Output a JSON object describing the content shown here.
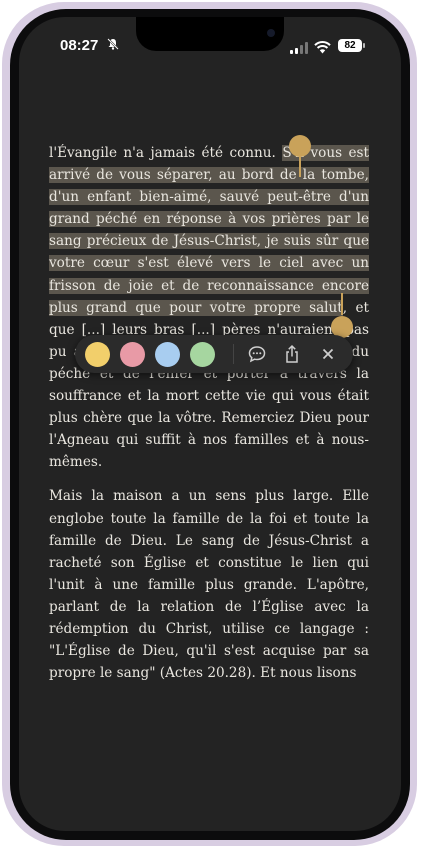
{
  "status": {
    "time": "08:27",
    "battery": "82"
  },
  "paragraphs": {
    "p1": {
      "before": "l'Évangile n'a jamais été connu. ",
      "highlight": "S'il vous est arrivé de vous séparer, au bord de la tombe, d'un enfant bien-aimé, sauvé peut-être d'un grand péché en réponse à vos prières par le sang précieux de Jésus-Christ, je suis sûr que votre cœur s'est élevé vers le ciel avec un frisson de joie et de reconnaissance encore plus grand que pour votre propre salut",
      "after": ", et que [...] leurs bras [...] pères n'auraient pas pu aller et qui ont pu sauver du gouffre du péché et de l'enfer et porter à travers la souffrance et la mort cette vie qui vous était plus chère que la vôtre. Remerciez Dieu pour l'Agneau qui suffit à nos familles et à nous-mêmes."
    },
    "p2": "Mais la maison a un sens plus large. Elle englobe toute la famille de la foi et toute la famille de Dieu. Le sang de Jésus-Christ a racheté son Église et constitue le lien qui l'unit à une famille plus grande. L'apôtre, parlant de la relation de l’Église avec la rédemption du Christ, utilise ce langage : \"L'Église de Dieu, qu'il s'est acquise par sa propre le sang\" (Actes 20.28). Et nous lisons"
  },
  "toolbar": {
    "colors": [
      "#f2cf6b",
      "#e89aa6",
      "#a8cdf0",
      "#a6d6a0"
    ],
    "color_names": [
      "yellow",
      "pink",
      "blue",
      "green"
    ],
    "icons": [
      "note-icon",
      "share-icon",
      "close-icon"
    ]
  }
}
